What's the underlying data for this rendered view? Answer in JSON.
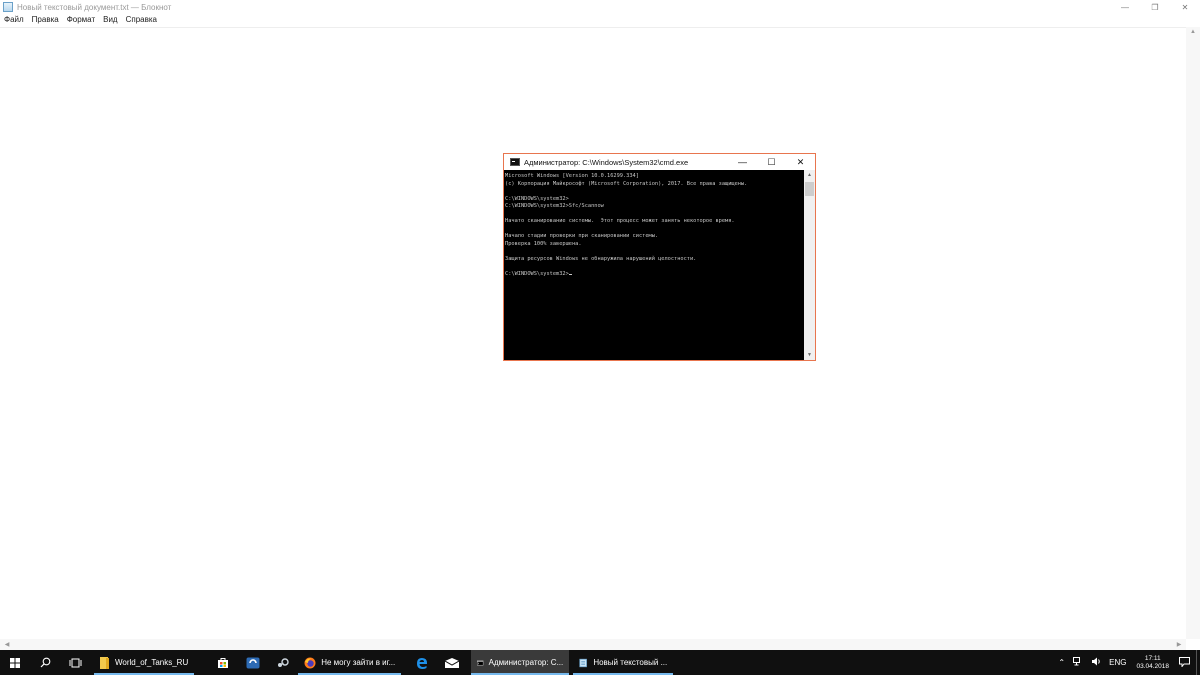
{
  "notepad": {
    "title": "Новый текстовый документ.txt — Блокнот",
    "controls": {
      "minimize": "—",
      "restore": "❐",
      "close": "✕"
    },
    "menu": [
      "Файл",
      "Правка",
      "Формат",
      "Вид",
      "Справка"
    ]
  },
  "cmd": {
    "title": "Администратор: C:\\Windows\\System32\\cmd.exe",
    "controls": {
      "minimize": "—",
      "maximize": "☐",
      "close": "✕"
    },
    "lines": [
      "Microsoft Windows [Version 10.0.16299.334]",
      "(c) Корпорация Майкрософт (Microsoft Corporation), 2017. Все права защищены.",
      "",
      "C:\\WINDOWS\\system32>",
      "C:\\WINDOWS\\system32>Sfc/Scannow",
      "",
      "Начато сканирование системы.  Этот процесс может занять некоторое время.",
      "",
      "Начало стадии проверки при сканировании системы.",
      "Проверка 100% завершена.",
      "",
      "Защита ресурсов Windows не обнаружила нарушений целостности.",
      "",
      "C:\\WINDOWS\\system32>"
    ]
  },
  "taskbar": {
    "start_icon": "windows-logo-icon",
    "search_icon": "search-icon",
    "taskview_icon": "task-view-icon",
    "apps": [
      {
        "name": "folder-icon",
        "label": "World_of_Tanks_RU"
      },
      {
        "name": "store-icon",
        "label": ""
      },
      {
        "name": "app-icon",
        "label": ""
      },
      {
        "name": "steam-icon",
        "label": ""
      },
      {
        "name": "firefox-icon",
        "label": "Не могу зайти в иг..."
      },
      {
        "name": "edge-icon",
        "label": ""
      },
      {
        "name": "mail-icon",
        "label": ""
      },
      {
        "name": "cmd-icon",
        "label": "Администратор: C..."
      },
      {
        "name": "notepad-icon",
        "label": "Новый текстовый ..."
      }
    ],
    "tray": {
      "language": "ENG",
      "time": "17:11",
      "date": "03.04.2018"
    }
  },
  "colors": {
    "cmd_border": "#e8754e",
    "taskbar": "#101010",
    "taskbar_active": "#3a3a3a",
    "accent": "#76b9ed"
  }
}
